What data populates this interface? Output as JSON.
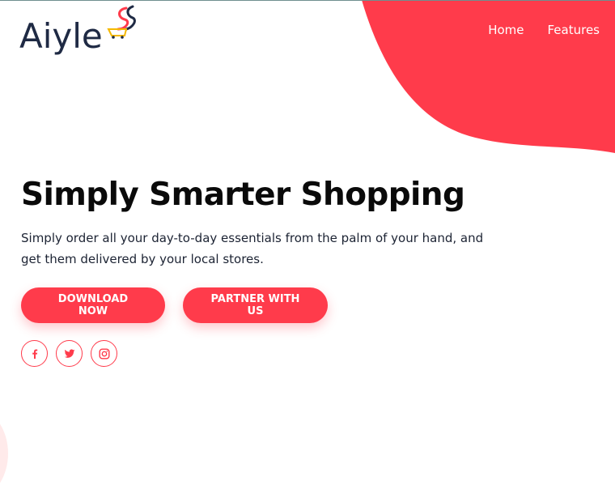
{
  "brand": {
    "name": "Aiyle",
    "accent": "#ff3b4b",
    "logo_mark": "shopping-bag-swoosh-icon"
  },
  "nav": {
    "items": [
      {
        "label": "Home"
      },
      {
        "label": "Features"
      }
    ]
  },
  "hero": {
    "title": "Simply Smarter Shopping",
    "subtitle": "Simply order all your day-to-day essentials from the palm of your hand, and get them delivered by your local stores."
  },
  "buttons": {
    "download": "DOWNLOAD NOW",
    "partner": "PARTNER WITH US"
  },
  "social": [
    {
      "icon": "facebook-icon"
    },
    {
      "icon": "twitter-icon"
    },
    {
      "icon": "instagram-icon"
    }
  ]
}
